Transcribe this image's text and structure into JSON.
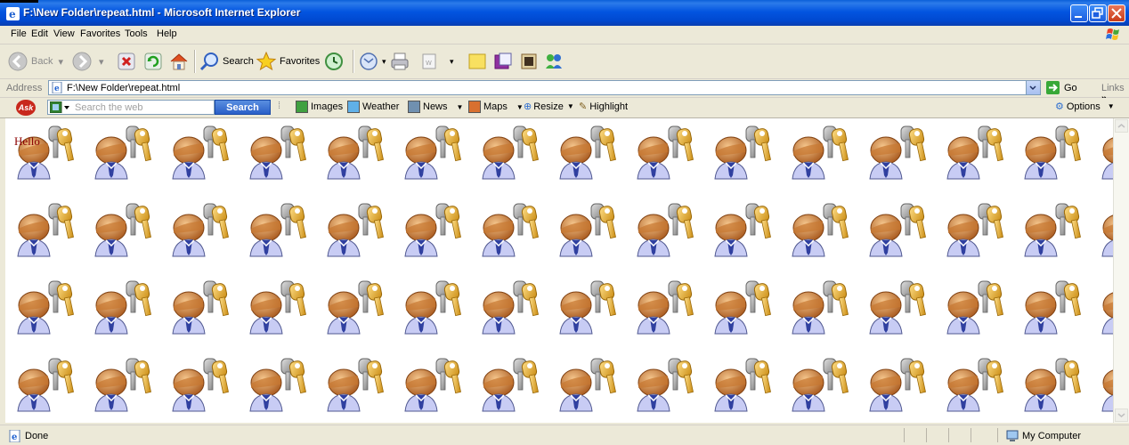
{
  "window": {
    "title": "F:\\New Folder\\repeat.html - Microsoft Internet Explorer"
  },
  "menu": {
    "items": [
      "File",
      "Edit",
      "View",
      "Favorites",
      "Tools",
      "Help"
    ]
  },
  "toolbar": {
    "back_label": "Back",
    "search_label": "Search",
    "favorites_label": "Favorites"
  },
  "address": {
    "label": "Address",
    "url": "F:\\New Folder\\repeat.html",
    "go_label": "Go",
    "links_label": "Links"
  },
  "ask": {
    "logo_text": "Ask",
    "search_placeholder": "Search the web",
    "search_button": "Search",
    "items": [
      "Images",
      "Weather",
      "News",
      "Maps",
      "Resize",
      "Highlight"
    ],
    "options_label": "Options"
  },
  "page": {
    "text": "Hello"
  },
  "status": {
    "text": "Done",
    "zone": "My Computer"
  }
}
